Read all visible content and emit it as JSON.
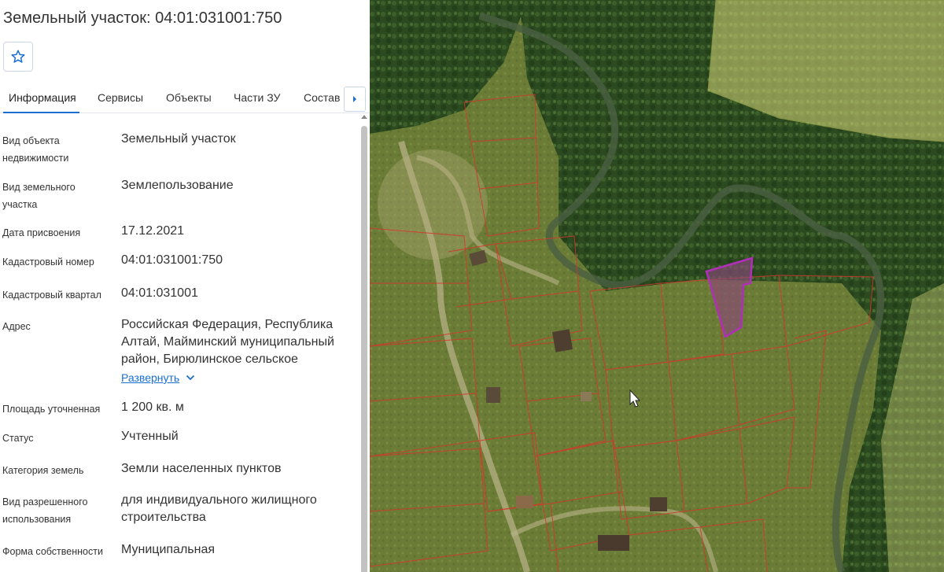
{
  "panel": {
    "title": "Земельный участок: 04:01:031001:750",
    "favorite_icon": "star-outline-icon",
    "tabs": [
      {
        "label": "Информация",
        "active": true
      },
      {
        "label": "Сервисы",
        "active": false
      },
      {
        "label": "Объекты",
        "active": false
      },
      {
        "label": "Части ЗУ",
        "active": false
      },
      {
        "label": "Состав",
        "active": false
      }
    ],
    "tab_next_icon": "caret-right-icon",
    "fields": [
      {
        "label": "Вид объекта недвижимости",
        "value": "Земельный участок"
      },
      {
        "label": "Вид земельного участка",
        "value": "Землепользование"
      },
      {
        "label": "Дата присвоения",
        "value": "17.12.2021"
      },
      {
        "label": "Кадастровый номер",
        "value": "04:01:031001:750"
      },
      {
        "label": "Кадастровый квартал",
        "value": "04:01:031001"
      },
      {
        "label": "Адрес",
        "value": "Российская Федерация, Республика Алтай, Майминский муниципальный район, Бирюлинское сельское"
      },
      {
        "label": "Площадь уточненная",
        "value": "1 200 кв. м"
      },
      {
        "label": "Статус",
        "value": "Учтенный"
      },
      {
        "label": "Категория земель",
        "value": "Земли населенных пунктов"
      },
      {
        "label": "Вид разрешенного использования",
        "value": "для индивидуального жилищного строительства"
      },
      {
        "label": "Форма собственности",
        "value": "Муниципальная"
      }
    ],
    "expand_label": "Развернуть",
    "expand_icon": "chevron-down-icon"
  },
  "colors": {
    "accent": "#1a6fd1",
    "parcel_border": "#d9342b",
    "selected_parcel": "#b02fb8",
    "forest": "#2f4a1f",
    "meadow": "#6f7f38",
    "overlay": "#d7d97a"
  },
  "map": {
    "cursor_icon": "mouse-pointer-icon"
  }
}
